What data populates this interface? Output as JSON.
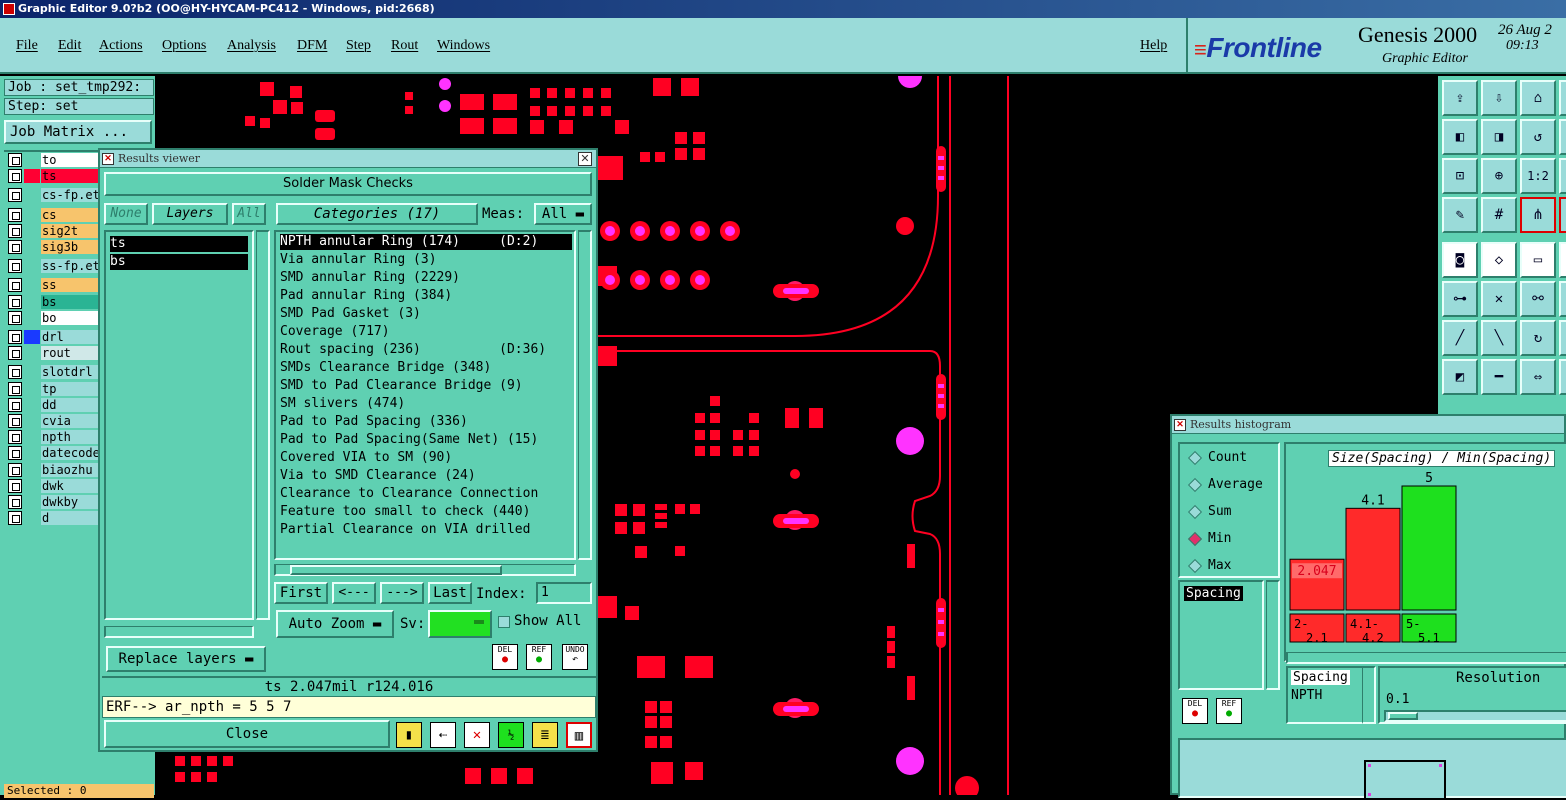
{
  "window": {
    "title": "Graphic Editor 9.0?b2 (OO@HY-HYCAM-PC412 - Windows, pid:2668)"
  },
  "menu": {
    "items": [
      "File",
      "Edit",
      "Actions",
      "Options",
      "Analysis",
      "DFM",
      "Step",
      "Rout",
      "Windows"
    ],
    "help": "Help"
  },
  "brand": {
    "logo": "Frontline",
    "product": "Genesis 2000",
    "subtitle": "Graphic Editor",
    "date": "26 Aug 2",
    "time": "09:13"
  },
  "job": {
    "job_line": "Job : set_tmp292:",
    "step_line": "Step: set",
    "matrix_button": "Job Matrix ..."
  },
  "layers": [
    {
      "name": "to",
      "color": "#ffffff"
    },
    {
      "name": "ts",
      "color": "#ff0033"
    },
    {
      "name": "cs-fp.et",
      "color": "#9adbd9"
    },
    {
      "name": "cs",
      "color": "#f7c46c"
    },
    {
      "name": "sig2t",
      "color": "#f7c46c"
    },
    {
      "name": "sig3b",
      "color": "#f7c46c"
    },
    {
      "name": "ss-fp.et",
      "color": "#9adbd9"
    },
    {
      "name": "ss",
      "color": "#f7c46c"
    },
    {
      "name": "bs",
      "color": "#2ab494"
    },
    {
      "name": "bo",
      "color": "#ffffff"
    },
    {
      "name": "drl",
      "color": "#9adbd9"
    },
    {
      "name": "rout",
      "color": "#d0e8e8"
    },
    {
      "name": "slotdrl",
      "color": "#9adbd9"
    },
    {
      "name": "tp",
      "color": "#9adbd9"
    },
    {
      "name": "dd",
      "color": "#9adbd9"
    },
    {
      "name": "cvia",
      "color": "#9adbd9"
    },
    {
      "name": "npth",
      "color": "#9adbd9"
    },
    {
      "name": "datecode",
      "color": "#9adbd9"
    },
    {
      "name": "biaozhu",
      "color": "#9adbd9"
    },
    {
      "name": "dwk",
      "color": "#9adbd9"
    },
    {
      "name": "dwkby",
      "color": "#9adbd9"
    },
    {
      "name": "d",
      "color": "#9adbd9"
    }
  ],
  "status": {
    "selected": "Selected : 0"
  },
  "results_viewer": {
    "title": "Results viewer",
    "header": "Solder Mask Checks",
    "none_btn": "None",
    "layers_btn": "Layers",
    "all_btn": "All",
    "layer_list": [
      "ts",
      "bs"
    ],
    "categories_btn": "Categories (17)",
    "meas_label": "Meas:",
    "meas_value": "All",
    "categories": [
      "NPTH annular Ring (174)     (D:2)",
      "Via annular Ring (3)",
      "SMD annular Ring (2229)",
      "Pad annular Ring (384)",
      "SMD Pad Gasket (3)",
      "Coverage (717)",
      "Rout spacing (236)          (D:36)",
      "SMDs Clearance Bridge (348)",
      "SMD to Pad Clearance Bridge (9)",
      "SM slivers (474)",
      "Pad to Pad Spacing (336)",
      "Pad to Pad Spacing(Same Net) (15)",
      "Covered VIA to SM (90)",
      "Via to SMD Clearance (24)",
      "Clearance to Clearance Connection",
      "Feature too small to check (440)",
      "Partial Clearance on VIA drilled"
    ],
    "nav": {
      "first": "First",
      "prev": "<---",
      "next": "--->",
      "last": "Last",
      "index_label": "Index:",
      "index_value": "1"
    },
    "auto_zoom": "Auto Zoom",
    "sv_label": "Sv:",
    "show_all": "Show All",
    "replace_layers": "Replace layers",
    "del": "DEL",
    "ref": "REF",
    "undo": "UNDO",
    "status_line": "ts 2.047mil  r124.016",
    "erf_line": "ERF--> ar_npth = 5 5 7",
    "close": "Close",
    "sv_color": "#22e022"
  },
  "histogram": {
    "title": "Results histogram",
    "modes": [
      "Count",
      "Average",
      "Sum",
      "Min",
      "Max"
    ],
    "selected_mode": "Min",
    "list": [
      "Spacing"
    ],
    "chart_title": "Size(Spacing) / Min(Spacing)",
    "bins": [
      "2-\n2.1",
      "4.1-\n4.2",
      "5-\n5.1"
    ],
    "del": "DEL",
    "ref": "REF",
    "meas_name": "Spacing",
    "meas_sub": "NPTH",
    "resolution_label": "Resolution",
    "resolution_value": "0.1",
    "chart_data": {
      "type": "bar",
      "categories": [
        "2-2.1",
        "4.1-4.2",
        "5-5.1"
      ],
      "values": [
        2.047,
        4.1,
        5
      ],
      "value_labels": [
        "2.047",
        "4.1",
        "5"
      ],
      "colors": [
        "#ff2a2a",
        "#ff2a2a",
        "#1ee01e"
      ],
      "title": "Size(Spacing) / Min(Spacing)",
      "ylim": [
        0,
        5
      ]
    }
  }
}
